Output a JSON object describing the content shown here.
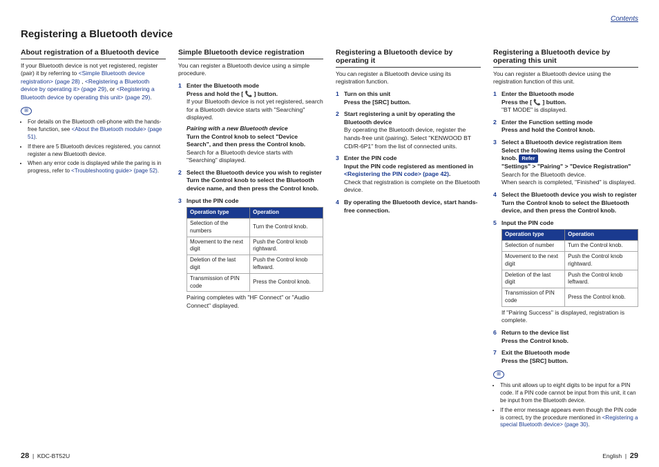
{
  "contentsLink": "Contents",
  "mainTitle": "Registering a Bluetooth device",
  "col1": {
    "h": "About registration of a Bluetooth device",
    "p1a": "If your Bluetooth device is not yet registered, register (pair) it by referring to ",
    "l1": "<Simple Bluetooth device registration> (page 28)",
    "p1b": " , ",
    "l2": "<Registering a Bluetooth device by operating it> (page 29)",
    "p1c": ", or ",
    "l3": "<Registering a Bluetooth device by operating this unit> (page 29)",
    "p1d": ".",
    "n1a": "For details on the Bluetooth cell-phone with the hands-free function, see ",
    "n1l": "<About the Bluetooth module> (page 51)",
    "n1b": ".",
    "n2": "If there are 5 Bluetooth devices registered, you cannot register a new Bluetooth device.",
    "n3a": "When any error code is displayed while the paring is in progress, refer to ",
    "n3l": "<Troubleshooting guide> (page 52)",
    "n3b": "."
  },
  "col2": {
    "h": "Simple Bluetooth device registration",
    "intro": "You can register a Bluetooth device using a simple procedure.",
    "s1t": "Enter the Bluetooth mode",
    "s1b": "Press and hold the [ 📞 ] button.",
    "s1p": "If your Bluetooth device is not yet registered, search for a Bluetooth device starts with \"Searching\" displayed.",
    "s1it": "Pairing with a new Bluetooth device",
    "s1c": "Turn the Control knob to select \"Device Search\", and then press the Control knob.",
    "s1d": "Search for a Bluetooth device starts with \"Searching\" displayed.",
    "s2t": "Select the Bluetooth device you wish to register",
    "s2b": "Turn the Control knob to select the Bluetooth device name, and then press the Control knob.",
    "s3t": "Input the PIN code",
    "th1": "Operation type",
    "th2": "Operation",
    "r1a": "Selection of the numbers",
    "r1b": "Turn the Control knob.",
    "r2a": "Movement to the next digit",
    "r2b": "Push the Control knob rightward.",
    "r3a": "Deletion of the last digit",
    "r3b": "Push the Control knob leftward.",
    "r4a": "Transmission of PIN code",
    "r4b": "Press the Control knob.",
    "tail": "Pairing completes with \"HF Connect\" or \"Audio Connect\" displayed."
  },
  "col3": {
    "h": "Registering a Bluetooth device by operating it",
    "intro": "You can register a Bluetooth device using its registration function.",
    "s1t": "Turn on this unit",
    "s1b": "Press the [SRC] button.",
    "s2t": "Start registering a unit by operating the Bluetooth device",
    "s2p": "By operating the Bluetooth device, register the hands-free unit (pairing). Select \"KENWOOD BT CD/R-6P1\" from the list of connected units.",
    "s3t": "Enter the PIN code",
    "s3b": "Input the PIN code registered as mentioned in ",
    "s3l": "<Registering the PIN code> (page 42)",
    "s3c": ".",
    "s3p": "Check that registration is complete on the Bluetooth device.",
    "s4t": "By operating the Bluetooth device, start hands-free connection."
  },
  "col4": {
    "h": "Registering a Bluetooth device by operating this unit",
    "intro": "You can register a Bluetooth device using the registration function of this unit.",
    "s1t": "Enter the Bluetooth mode",
    "s1b": "Press the [ 📞 ] button.",
    "s1p": "\"BT MODE\" is displayed.",
    "s2t": "Enter the Function setting mode",
    "s2b": "Press and hold the Control knob.",
    "s3t": "Select a Bluetooth device registration item",
    "s3b": "Select the following items using the Control knob.",
    "refer": "Refer",
    "s3c": "\"Settings\" > \"Pairing\" > \"Device Registration\"",
    "s3p": "Search for the Bluetooth device.",
    "s3q": "When search is completed, \"Finished\" is displayed.",
    "s4t": "Select the Bluetooth device you wish to register",
    "s4b": "Turn the Control knob to select the Bluetooth device, and then press the Control knob.",
    "s5t": "Input the PIN code",
    "th1": "Operation type",
    "th2": "Operation",
    "r1a": "Selection of number",
    "r1b": "Turn the Control knob.",
    "r2a": "Movement to the next digit",
    "r2b": "Push the Control knob rightward.",
    "r3a": "Deletion of the last digit",
    "r3b": "Push the Control knob leftward.",
    "r4a": "Transmission of PIN code",
    "r4b": "Press the Control knob.",
    "s5p": "If \"Pairing Success\" is displayed, registration is complete.",
    "s6t": "Return to the device list",
    "s6b": "Press the Control knob.",
    "s7t": "Exit the Bluetooth mode",
    "s7b": "Press the [SRC] button.",
    "n1": "This unit allows up to eight digits to be input for a PIN code. If a PIN code cannot be input from this unit, it can be input from the Bluetooth device.",
    "n2a": "If the error message appears even though the PIN code is correct, try the procedure mentioned in ",
    "n2l": "<Registering a special Bluetooth device> (page 30)",
    "n2b": "."
  },
  "footer": {
    "leftPage": "28",
    "leftModel": "KDC-BT52U",
    "rightLang": "English",
    "rightPage": "29"
  }
}
